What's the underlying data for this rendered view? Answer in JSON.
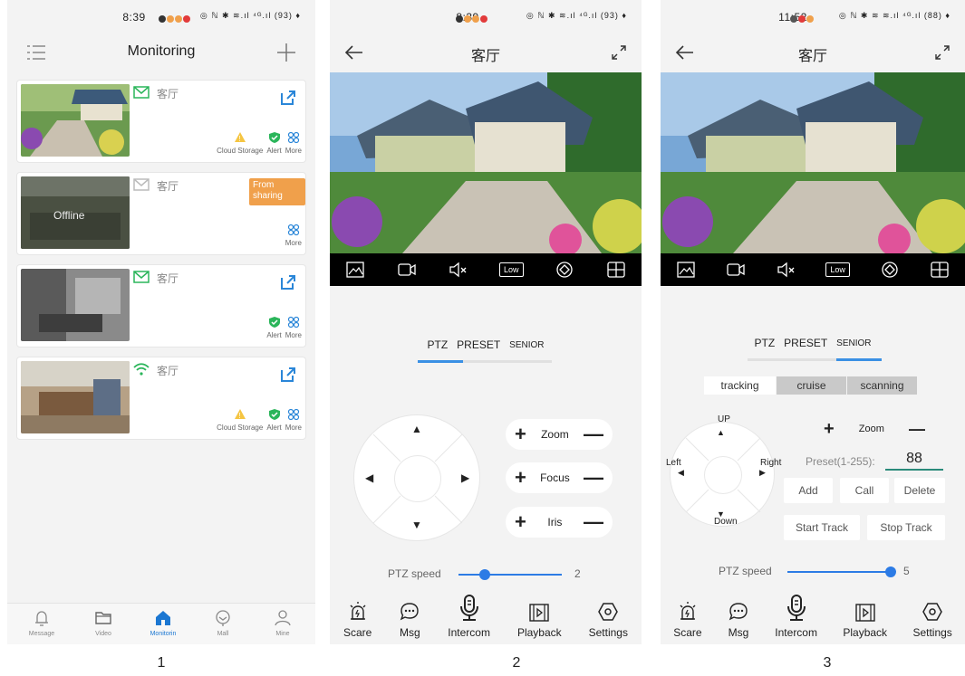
{
  "captions": [
    "1",
    "2",
    "3"
  ],
  "phone1": {
    "status_time": "8:39",
    "status_icons": "◎ ℕ ✱ ≋.ıl ⁴ᴳ.ıl (93) ♦",
    "title": "Monitoring",
    "cards": [
      {
        "name": "客厅",
        "actions": [
          "Cloud Storage",
          "Alert",
          "More"
        ]
      },
      {
        "name": "客厅",
        "offline": "Offline",
        "badge": "From sharing",
        "actions": [
          "More"
        ]
      },
      {
        "name": "客厅",
        "actions": [
          "Alert",
          "More"
        ]
      },
      {
        "name": "客厅",
        "actions": [
          "Cloud Storage",
          "Alert",
          "More"
        ]
      }
    ],
    "tabbar": [
      "Message",
      "Video",
      "Monitorin",
      "Mall",
      "Mine"
    ],
    "active_tab": "Monitorin"
  },
  "phone2": {
    "status_time": "8:39",
    "status_icons": "◎ ℕ ✱ ≋.ıl ⁴ᴳ.ıl (93) ♦",
    "title": "客厅",
    "quality": "Low",
    "tabs": [
      "PTZ",
      "PRESET",
      "SENIOR"
    ],
    "active_tab": "PTZ",
    "zoom": "Zoom",
    "focus": "Focus",
    "iris": "Iris",
    "speed_label": "PTZ speed",
    "speed_value": "2",
    "speed_fraction": 0.25,
    "bottom": [
      "Scare",
      "Msg",
      "Intercom",
      "Playback",
      "Settings"
    ]
  },
  "phone3": {
    "status_time": "11:52",
    "status_icons": "◎ ℕ ✱ ≋ ≋.ıl ⁴ᴳ.ıl (88) ♦",
    "title": "客厅",
    "quality": "Low",
    "tabs": [
      "PTZ",
      "PRESET",
      "SENIOR"
    ],
    "active_tab": "SENIOR",
    "modes": [
      "tracking",
      "cruise",
      "scanning"
    ],
    "active_mode": "tracking",
    "up": "UP",
    "down": "Down",
    "left": "Left",
    "right": "Right",
    "zoom": "Zoom",
    "preset_label": "Preset(1-255):",
    "preset_value": "88",
    "add": "Add",
    "call": "Call",
    "delete": "Delete",
    "start_track": "Start Track",
    "stop_track": "Stop Track",
    "speed_label": "PTZ speed",
    "speed_value": "5",
    "speed_fraction": 1.0,
    "bottom": [
      "Scare",
      "Msg",
      "Intercom",
      "Playback",
      "Settings"
    ]
  },
  "colors": {
    "accent": "#3a90e4",
    "green": "#2ab55a",
    "share": "#2a86d8",
    "badge": "#f0a04b"
  }
}
